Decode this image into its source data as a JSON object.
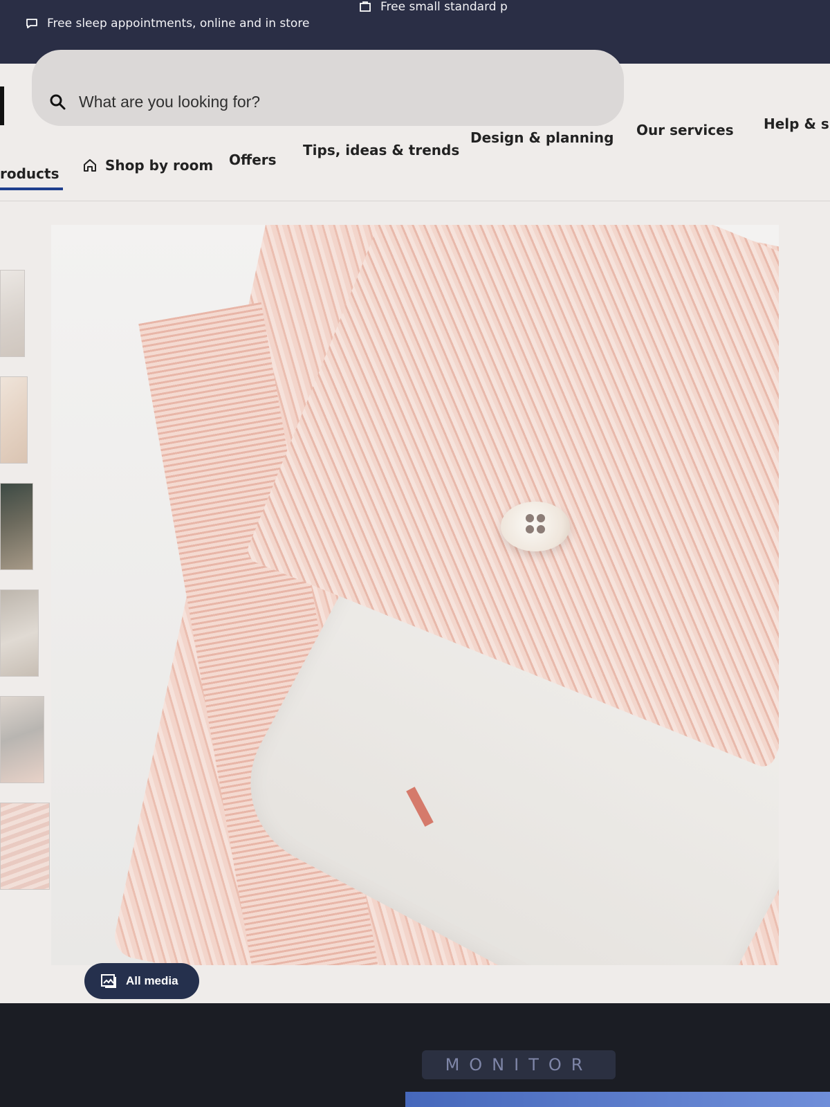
{
  "topbar": {
    "promo_left": "Free sleep appointments, online and in store",
    "promo_right": "Free small standard p",
    "icons": [
      "chat-bubble-icon",
      "box-icon"
    ]
  },
  "search": {
    "placeholder": "What are you looking for?",
    "icon": "search-icon"
  },
  "nav": {
    "items": [
      {
        "label": "roducts",
        "active": true
      },
      {
        "label": "Shop by room",
        "icon": "home-icon"
      },
      {
        "label": "Offers"
      },
      {
        "label": "Tips, ideas & trends"
      },
      {
        "label": "Design & planning"
      },
      {
        "label": "Our services"
      },
      {
        "label": "Help & su"
      }
    ]
  },
  "gallery": {
    "thumbnail_count": 6,
    "all_media_label": "All media",
    "all_media_icon": "media-gallery-icon"
  },
  "monitor": {
    "brand": "MONITOR"
  },
  "colors": {
    "topbar": "#2a2e45",
    "nav_active": "#1f3f8e",
    "button": "#25304d"
  }
}
